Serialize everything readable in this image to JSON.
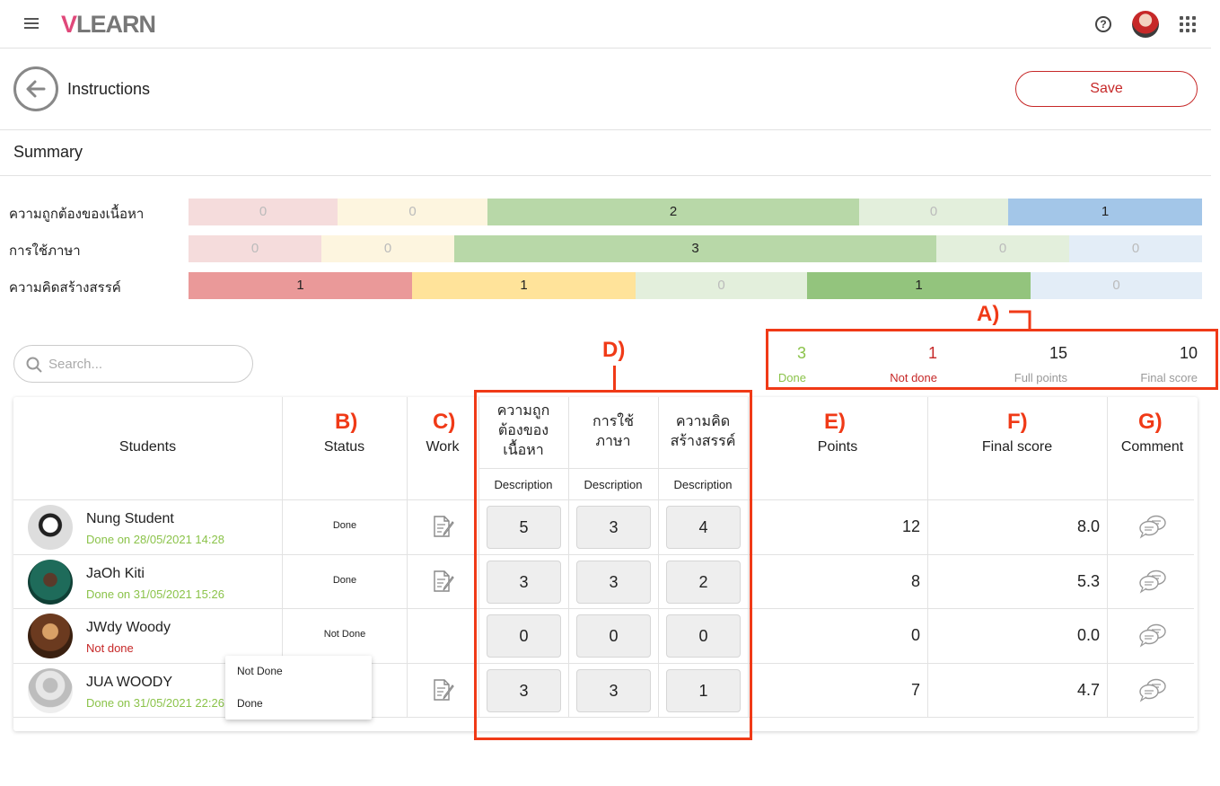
{
  "app": {
    "logo_v": "V",
    "logo_rest": "LEARN"
  },
  "header": {
    "title": "Instructions",
    "save_label": "Save"
  },
  "summary": {
    "title": "Summary",
    "rows": [
      {
        "label": "ความถูกต้องของเนื้อหา",
        "segments": [
          {
            "value": "0",
            "width": 166,
            "bg": "#f5dcdc",
            "fg": "#bbb"
          },
          {
            "value": "0",
            "width": 167,
            "bg": "#fdf5df",
            "fg": "#bbb"
          },
          {
            "value": "2",
            "width": 414,
            "bg": "#b8d8a8",
            "fg": "#222"
          },
          {
            "value": "0",
            "width": 166,
            "bg": "#e3efdc",
            "fg": "#bbb"
          },
          {
            "value": "1",
            "width": 216,
            "bg": "#a3c6e8",
            "fg": "#222"
          }
        ]
      },
      {
        "label": "การใช้ภาษา",
        "segments": [
          {
            "value": "0",
            "width": 148,
            "bg": "#f5dcdc",
            "fg": "#bbb"
          },
          {
            "value": "0",
            "width": 148,
            "bg": "#fdf5df",
            "fg": "#bbb"
          },
          {
            "value": "3",
            "width": 537,
            "bg": "#b8d8a8",
            "fg": "#222"
          },
          {
            "value": "0",
            "width": 148,
            "bg": "#e3efdc",
            "fg": "#bbb"
          },
          {
            "value": "0",
            "width": 148,
            "bg": "#e3edf7",
            "fg": "#bbb"
          }
        ]
      },
      {
        "label": "ความคิดสร้างสรรค์",
        "segments": [
          {
            "value": "1",
            "width": 249,
            "bg": "#ea9999",
            "fg": "#222"
          },
          {
            "value": "1",
            "width": 249,
            "bg": "#ffe39a",
            "fg": "#222"
          },
          {
            "value": "0",
            "width": 191,
            "bg": "#e3efdc",
            "fg": "#bbb"
          },
          {
            "value": "1",
            "width": 249,
            "bg": "#93c47d",
            "fg": "#222"
          },
          {
            "value": "0",
            "width": 191,
            "bg": "#e3edf7",
            "fg": "#bbb"
          }
        ]
      }
    ]
  },
  "search": {
    "placeholder": "Search..."
  },
  "stats": {
    "done": {
      "value": "3",
      "label": "Done"
    },
    "not_done": {
      "value": "1",
      "label": "Not done"
    },
    "full_points": {
      "value": "15",
      "label": "Full points"
    },
    "final_score": {
      "value": "10",
      "label": "Final score"
    }
  },
  "annotations": {
    "a": "A)",
    "b": "B)",
    "c": "C)",
    "d": "D)",
    "e": "E)",
    "f": "F)",
    "g": "G)"
  },
  "table": {
    "headers": {
      "students": "Students",
      "status": "Status",
      "work": "Work",
      "points": "Points",
      "final_score": "Final score",
      "comment": "Comment"
    },
    "criteria": [
      {
        "line1": "ความถูก",
        "line2": "ต้องของ",
        "line3": "เนื้อหา",
        "desc": "Description"
      },
      {
        "line1": "การใช้",
        "line2": "ภาษา",
        "line3": "",
        "desc": "Description"
      },
      {
        "line1": "ความคิด",
        "line2": "สร้างสรรค์",
        "line3": "",
        "desc": "Description"
      }
    ],
    "rows": [
      {
        "name": "Nung Student",
        "sub": "Done on 28/05/2021 14:28",
        "status": "Done",
        "scores": [
          "5",
          "3",
          "4"
        ],
        "points": "12",
        "final": "8.0"
      },
      {
        "name": "JaOh Kiti",
        "sub": "Done on 31/05/2021 15:26",
        "status": "Done",
        "scores": [
          "3",
          "3",
          "2"
        ],
        "points": "8",
        "final": "5.3"
      },
      {
        "name": "JWdy Woody",
        "sub": "Not done",
        "status": "Not Done",
        "scores": [
          "0",
          "0",
          "0"
        ],
        "points": "0",
        "final": "0.0"
      },
      {
        "name": "JUA WOODY",
        "sub": "Done on 31/05/2021 22:26",
        "status": "",
        "scores": [
          "3",
          "3",
          "1"
        ],
        "points": "7",
        "final": "4.7"
      }
    ]
  },
  "status_dropdown": {
    "options": [
      "Not Done",
      "Done"
    ]
  },
  "colors": {
    "accent_red": "#c62828",
    "done_green": "#8bc34a",
    "annotation_red": "#f03a17"
  }
}
